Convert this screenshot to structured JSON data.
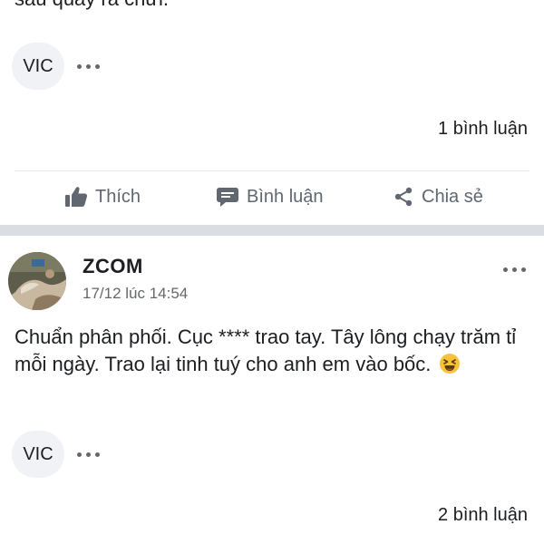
{
  "post_top": {
    "cut_text": "sau quay ra chửi. ^^",
    "chip_label": "VIC",
    "comment_count": "1 bình luận"
  },
  "actions": {
    "like_label": "Thích",
    "comment_label": "Bình luận",
    "share_label": "Chia sẻ"
  },
  "post": {
    "author": "ZCOM",
    "timestamp": "17/12 lúc 14:54",
    "text": "Chuẩn phân phối. Cục **** trao tay. Tây lông chạy trăm tỉ mỗi ngày. Trao lại tinh tuý cho anh em vào bốc.",
    "emoji": "laughing-face",
    "chip_label": "VIC",
    "comment_count": "2 bình luận"
  },
  "colors": {
    "text": "#1c1e21",
    "secondary": "#65676b",
    "action": "#606770",
    "chip_bg": "#f0f2f5",
    "separator": "#dadde1"
  }
}
